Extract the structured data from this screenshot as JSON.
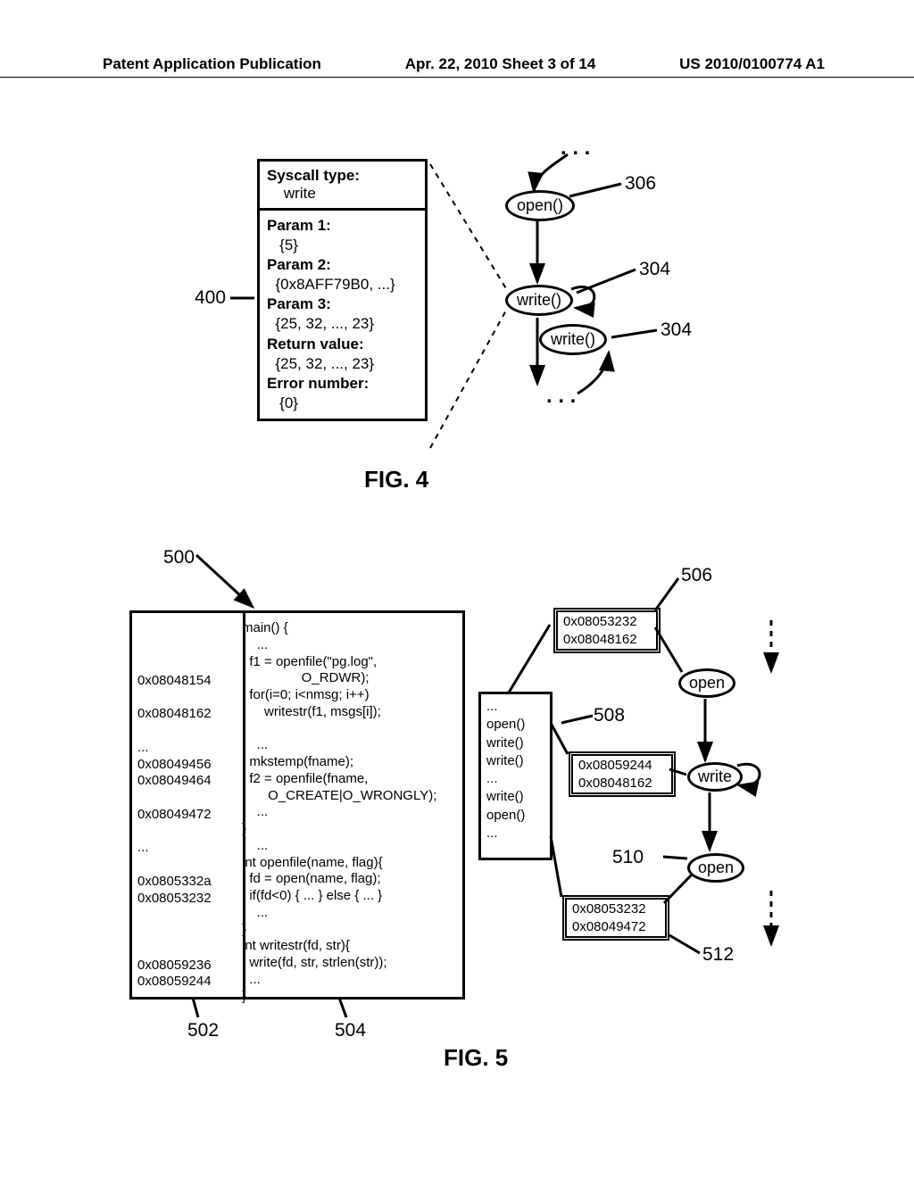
{
  "header": {
    "left": "Patent Application Publication",
    "center": "Apr. 22, 2010  Sheet 3 of 14",
    "right": "US 2010/0100774 A1"
  },
  "fig4": {
    "title": "FIG. 4",
    "box_title": "Syscall type:",
    "box_title_val": "write",
    "p1": "Param 1:",
    "p1v": "{5}",
    "p2": "Param 2:",
    "p2v": "{0x8AFF79B0, ...}",
    "p3": "Param 3:",
    "p3v": "{25, 32, ..., 23}",
    "ret": "Return value:",
    "retv": "{25, 32, ..., 23}",
    "err": "Error number:",
    "errv": "{0}",
    "node_open": "open()",
    "node_write1": "write()",
    "node_write2": "write()",
    "label_400": "400",
    "label_306": "306",
    "label_304a": "304",
    "label_304b": "304"
  },
  "fig5": {
    "title": "FIG. 5",
    "label_500": "500",
    "label_502": "502",
    "label_504": "504",
    "label_506": "506",
    "label_508": "508",
    "label_510": "510",
    "label_512": "512",
    "addrs": "\n0x08048154\n\n0x08048162\n\n...\n0x08049456\n0x08049464\n\n0x08049472\n\n...\n\n0x0805332a\n0x08053232\n\n\n\n0x08059236\n0x08059244",
    "code": "main() {\n    ...\n  f1 = openfile(\"pg.log\",\n                O_RDWR);\n  for(i=0; i<nmsg; i++)\n      writestr(f1, msgs[i]);\n\n    ...\n  mkstemp(fname);\n  f2 = openfile(fname,\n       O_CREATE|O_WRONGLY);\n    ...\n}\n    ...\nint openfile(name, flag){\n  fd = open(name, flag);\n  if(fd<0) { ... } else { ... }\n    ...\n}\nint writestr(fd, str){\n  write(fd, str, strlen(str));\n  ...\n}",
    "syscalls": "...\nopen()\nwrite()\nwrite()\n...\nwrite()\nopen()\n...",
    "tag506a": "0x08053232",
    "tag506b": "0x08048162",
    "tag_w_a": "0x08059244",
    "tag_w_b": "0x08048162",
    "tag512a": "0x08053232",
    "tag512b": "0x08049472",
    "node_open1": "open",
    "node_write": "write",
    "node_open2": "open"
  }
}
